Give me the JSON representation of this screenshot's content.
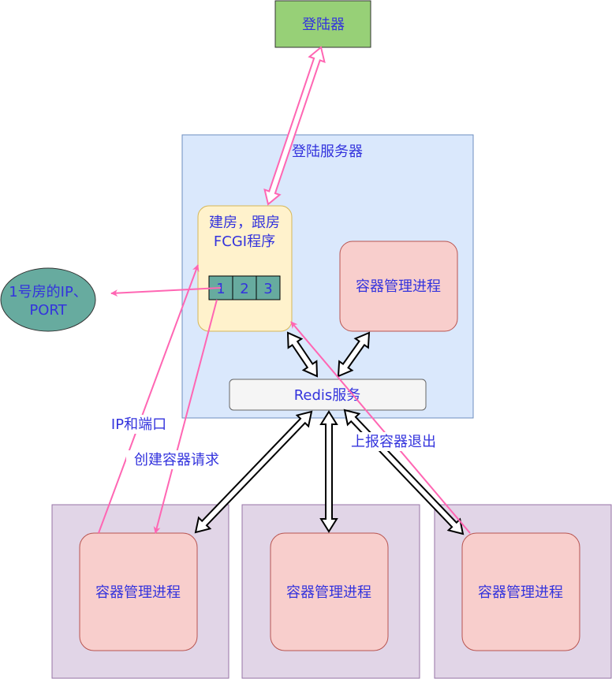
{
  "colors": {
    "text": "#3333dd",
    "login_fill": "#97d077",
    "login_stroke": "#333333",
    "server_fill": "#dae8fc",
    "server_stroke": "#6c8ebf",
    "fcgi_fill": "#fff2cc",
    "fcgi_stroke": "#d6b656",
    "container_fill": "#f8cecc",
    "container_stroke": "#b85450",
    "host_fill": "#e1d5e7",
    "host_stroke": "#9673a6",
    "redis_fill": "#f5f5f5",
    "redis_stroke": "#666666",
    "ellipse_fill": "#67ab9f",
    "ellipse_stroke": "#333333",
    "pink_arrow": "#ff66b3",
    "black_arrow": "#000000"
  },
  "login": {
    "label": "登陆器"
  },
  "login_server": {
    "label": "登陆服务器",
    "fcgi": {
      "line1": "建房，跟房",
      "line2": "FCGI程序",
      "slots": [
        "1",
        "2",
        "3"
      ]
    },
    "container_manager": {
      "label": "容器管理进程"
    },
    "redis": {
      "label": "Redis服务"
    }
  },
  "room_info": {
    "line1": "1号房的IP、",
    "line2": "PORT"
  },
  "edge_labels": {
    "ip_port": "IP和端口",
    "create_request": "创建容器请求",
    "report_exit": "上报容器退出"
  },
  "hosts": [
    {
      "container_manager": {
        "label": "容器管理进程"
      }
    },
    {
      "container_manager": {
        "label": "容器管理进程"
      }
    },
    {
      "container_manager": {
        "label": "容器管理进程"
      }
    }
  ]
}
